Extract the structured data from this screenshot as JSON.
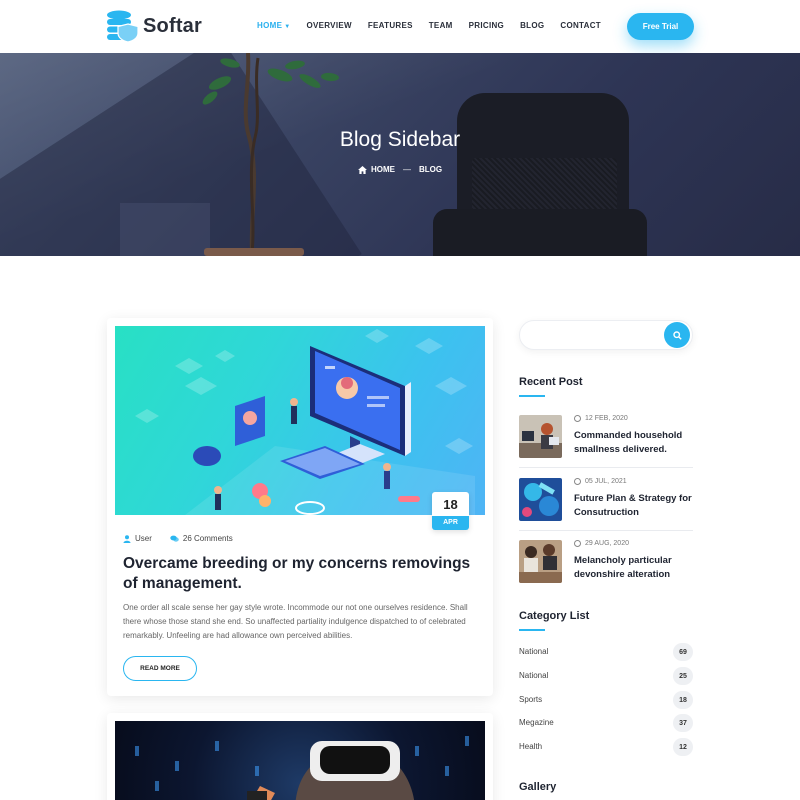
{
  "brand": {
    "name": "Softar",
    "accent": "#2ab6f0"
  },
  "nav": {
    "items": [
      {
        "label": "HOME",
        "active": true
      },
      {
        "label": "OVERVIEW"
      },
      {
        "label": "FEATURES"
      },
      {
        "label": "TEAM"
      },
      {
        "label": "PRICING"
      },
      {
        "label": "BLOG"
      },
      {
        "label": "CONTACT"
      }
    ],
    "cta_label": "Free Trial"
  },
  "hero": {
    "title": "Blog Sidebar",
    "breadcrumb": [
      "HOME",
      "BLOG"
    ]
  },
  "post": {
    "date_day": "18",
    "date_month": "APR",
    "author": "User",
    "comments": "26 Comments",
    "title": "Overcame breeding or my concerns removings of management.",
    "excerpt": "One order all scale sense her gay style wrote. Incommode our not one ourselves residence. Shall there whose those stand she end. So unaffected partiality indulgence dispatched to of celebrated remarkably. Unfeeling are had allowance own perceived abilities.",
    "read_more": "READ MORE"
  },
  "sidebar": {
    "search_placeholder": "",
    "recent_title": "Recent Post",
    "recent_posts": [
      {
        "date": "12 FEB, 2020",
        "title": "Commanded household smallness delivered."
      },
      {
        "date": "05 JUL, 2021",
        "title": "Future Plan & Strategy for Consutruction"
      },
      {
        "date": "29 AUG, 2020",
        "title": "Melancholy particular devonshire alteration"
      }
    ],
    "category_title": "Category List",
    "categories": [
      {
        "name": "National",
        "count": "69"
      },
      {
        "name": "National",
        "count": "25"
      },
      {
        "name": "Sports",
        "count": "18"
      },
      {
        "name": "Megazine",
        "count": "37"
      },
      {
        "name": "Health",
        "count": "12"
      }
    ],
    "gallery_title": "Gallery"
  }
}
